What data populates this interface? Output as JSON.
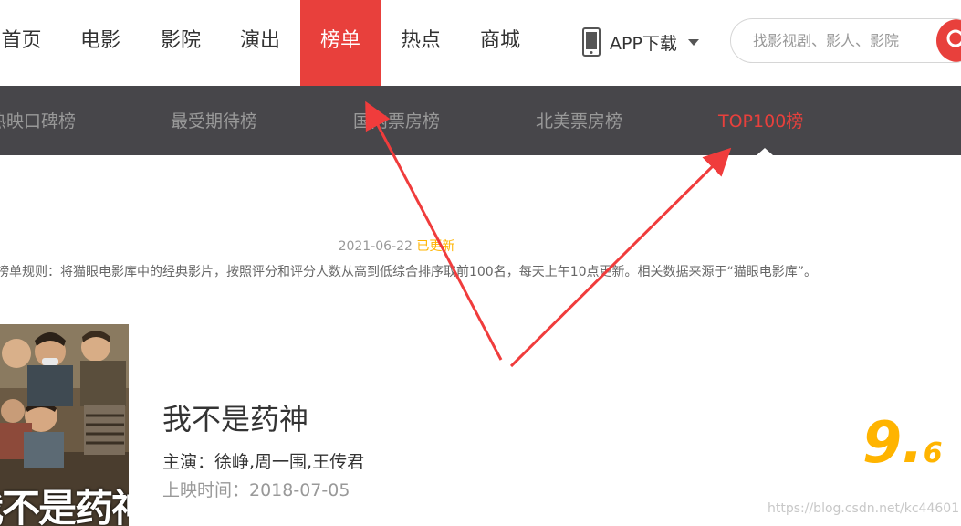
{
  "nav": {
    "items": [
      {
        "label": "首页"
      },
      {
        "label": "电影"
      },
      {
        "label": "影院"
      },
      {
        "label": "演出"
      },
      {
        "label": "榜单",
        "active": true
      },
      {
        "label": "热点"
      },
      {
        "label": "商城"
      }
    ],
    "app_download": "APP下载",
    "search": {
      "placeholder": "找影视剧、影人、影院"
    },
    "accent": "#e8403c"
  },
  "subnav": {
    "items": [
      {
        "label": "热映口碑榜"
      },
      {
        "label": "最受期待榜"
      },
      {
        "label": "国内票房榜"
      },
      {
        "label": "北美票房榜"
      },
      {
        "label": "TOP100榜",
        "active": true
      }
    ]
  },
  "board": {
    "update_date": "2021-06-22",
    "update_flag": "已更新",
    "rule_text": "榜单规则：将猫眼电影库中的经典影片，按照评分和评分人数从高到低综合排序取前100名，每天上午10点更新。相关数据来源于“猫眼电影库”。"
  },
  "movie": {
    "title": "我不是药神",
    "stars": "主演：徐峥,周一围,王传君",
    "release": "上映时间：2018-07-05",
    "score_int": "9.",
    "score_frac": "6",
    "poster_text": "我不是药神"
  },
  "watermark": "https://blog.csdn.net/kc44601",
  "colors": {
    "score": "#ffb400",
    "subnav_bg": "#47464a",
    "annotation": "#f03c3c"
  }
}
